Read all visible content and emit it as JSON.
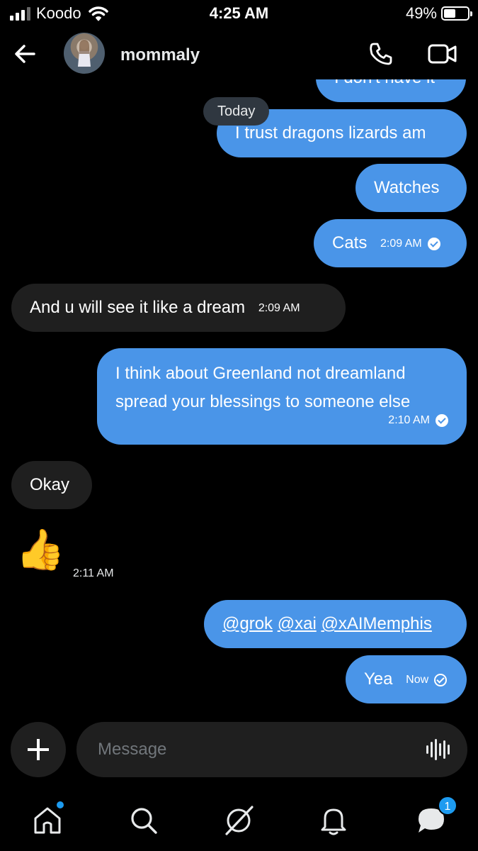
{
  "status_bar": {
    "carrier": "Koodo",
    "time": "4:25 AM",
    "battery": "49%",
    "battery_level": 0.49
  },
  "header": {
    "contact_name": "mommaly"
  },
  "chat": {
    "partial_message": "I don't have it",
    "today_label": "Today",
    "messages": [
      {
        "text": "I trust dragons lizards am"
      },
      {
        "text": "Watches"
      },
      {
        "text": "Cats",
        "time": "2:09 AM"
      },
      {
        "text": "And u will see it like a dream",
        "time": "2:09 AM"
      },
      {
        "text_line1": "I think about Greenland not dreamland",
        "text_line2": "spread your blessings to someone else",
        "time": "2:10 AM"
      },
      {
        "text": "Okay"
      },
      {
        "emoji": "👍",
        "time": "2:11 AM"
      },
      {
        "mentions": [
          "@grok",
          "@xai",
          "@xAIMemphis"
        ]
      },
      {
        "text": "Yea",
        "time": "Now"
      }
    ]
  },
  "composer": {
    "placeholder": "Message"
  },
  "nav": {
    "messages_badge": "1"
  }
}
